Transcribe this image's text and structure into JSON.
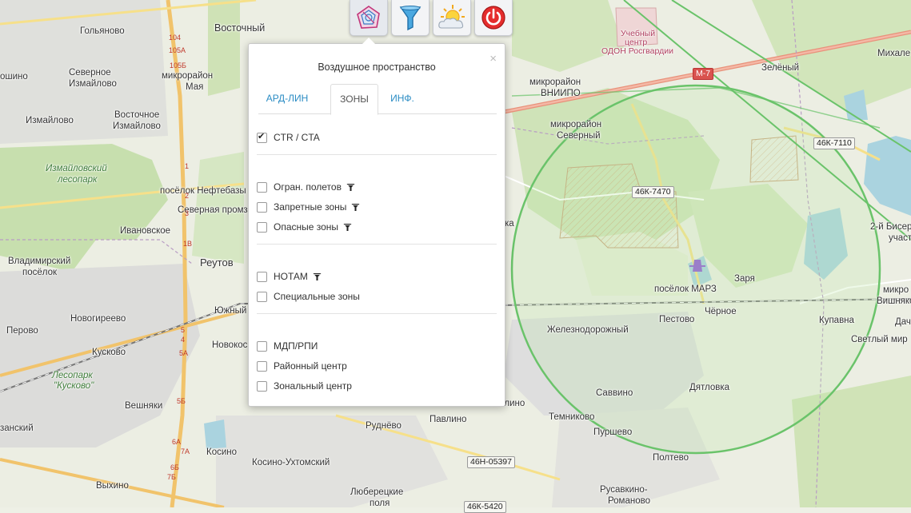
{
  "toolbar": {
    "items": [
      {
        "name": "airspace-tool-button",
        "icon": "airspace-radar-icon"
      },
      {
        "name": "filter-tool-button",
        "icon": "funnel-icon"
      },
      {
        "name": "weather-tool-button",
        "icon": "sun-cloud-icon"
      },
      {
        "name": "power-tool-button",
        "icon": "power-icon"
      }
    ]
  },
  "panel": {
    "title": "Воздушное пространство",
    "close": "×",
    "tabs": [
      "АРД-ЛИН",
      "ЗОНЫ",
      "ИНФ."
    ],
    "active_tab": "ЗОНЫ",
    "groups": [
      [
        {
          "label": "CTR / CTA",
          "checked": true,
          "filter": false
        }
      ],
      [
        {
          "label": "Огран. полетов",
          "checked": false,
          "filter": true
        },
        {
          "label": "Запретные зоны",
          "checked": false,
          "filter": true
        },
        {
          "label": "Опасные зоны",
          "checked": false,
          "filter": true
        }
      ],
      [
        {
          "label": "НОТАМ",
          "checked": false,
          "filter": true
        },
        {
          "label": "Специальные зоны",
          "checked": false,
          "filter": false
        }
      ],
      [
        {
          "label": "МДП/РПИ",
          "checked": false,
          "filter": false
        },
        {
          "label": "Районный центр",
          "checked": false,
          "filter": false
        },
        {
          "label": "Зональный центр",
          "checked": false,
          "filter": false
        }
      ]
    ]
  },
  "map": {
    "labels": {
      "golyanovo": "Гольяново",
      "vostochny": "Восточный",
      "oshino": "ошино",
      "sev_izm_1": "Северное",
      "sev_izm_2": "Измайлово",
      "mikro_maya_1": "микрорайон",
      "mikro_maya_2": "Мая",
      "izmaylovo": "Измайлово",
      "vost_izm_1": "Восточное",
      "vost_izm_2": "Измайлово",
      "izm_les_1": "Измайловский",
      "izm_les_2": "лесопарк",
      "neftebaza": "посёлок Нефтебазы",
      "sev_promzona": "Северная промз",
      "ivanovskoe": "Ивановское",
      "vlad_1": "Владимирский",
      "vlad_2": "посёлок",
      "reutov": "Реутов",
      "yuzhny": "Южный",
      "novogireevo": "Новогиреево",
      "perovo": "Перово",
      "novokos": "Новокос",
      "kuskovo": "Кусково",
      "kusk_park_1": "Лесопарк",
      "kusk_park_2": "\"Кусково\"",
      "veshnyaki": "Вешняки",
      "zanskiy": "занский",
      "kosino": "Косино",
      "kosino_ukht": "Косино-Ухтомский",
      "vykhino": "Выхино",
      "lyub_1": "Люберецкие",
      "lyub_2": "поля",
      "rudnevo": "Руднёво",
      "pavlino": "Павлино",
      "nikolino": "осолино",
      "temnikovo": "Темниково",
      "savvino": "Саввино",
      "purshevo": "Пуршево",
      "poltevo": "Полтево",
      "rusavkino_1": "Русавкино-",
      "rusavkino_2": "Романово",
      "dyatlovka": "Дятловка",
      "zheleznodor": "Железнодорожный",
      "pestovo": "Пестово",
      "chernoe": "Чёрное",
      "kupavna": "Купавна",
      "svetly": "Светлый мир",
      "vishnyak_1": "микро",
      "vishnyak_2": "Вишняко",
      "vishnyak_3": "Дач",
      "bis_1": "2-й Бисеро",
      "bis_2": "участ",
      "zarya": "Заря",
      "marz": "посёлок МАРЗ",
      "sev_mr_1": "микрорайон",
      "sev_mr_2": "Северный",
      "vniipo_1": "микрорайон",
      "vniipo_2": "ВНИИПО",
      "zeleny": "Зелёный",
      "mikhal": "Михале",
      "odon_1": "Учебный",
      "odon_2": "центр",
      "odon_3": "ОДОН Росгвардии",
      "ka": "ка"
    },
    "shields": {
      "m7": "М-7",
      "k7470": "46К-7470",
      "k7110": "46К-7110",
      "n05397": "46Н-05397",
      "k5420": "46К-5420"
    },
    "km_marks": [
      "104",
      "105А",
      "105Б",
      "1",
      "2",
      "3",
      "1В",
      "5",
      "4",
      "5А",
      "5Б",
      "6А",
      "6Б",
      "7А",
      "7Б"
    ]
  }
}
